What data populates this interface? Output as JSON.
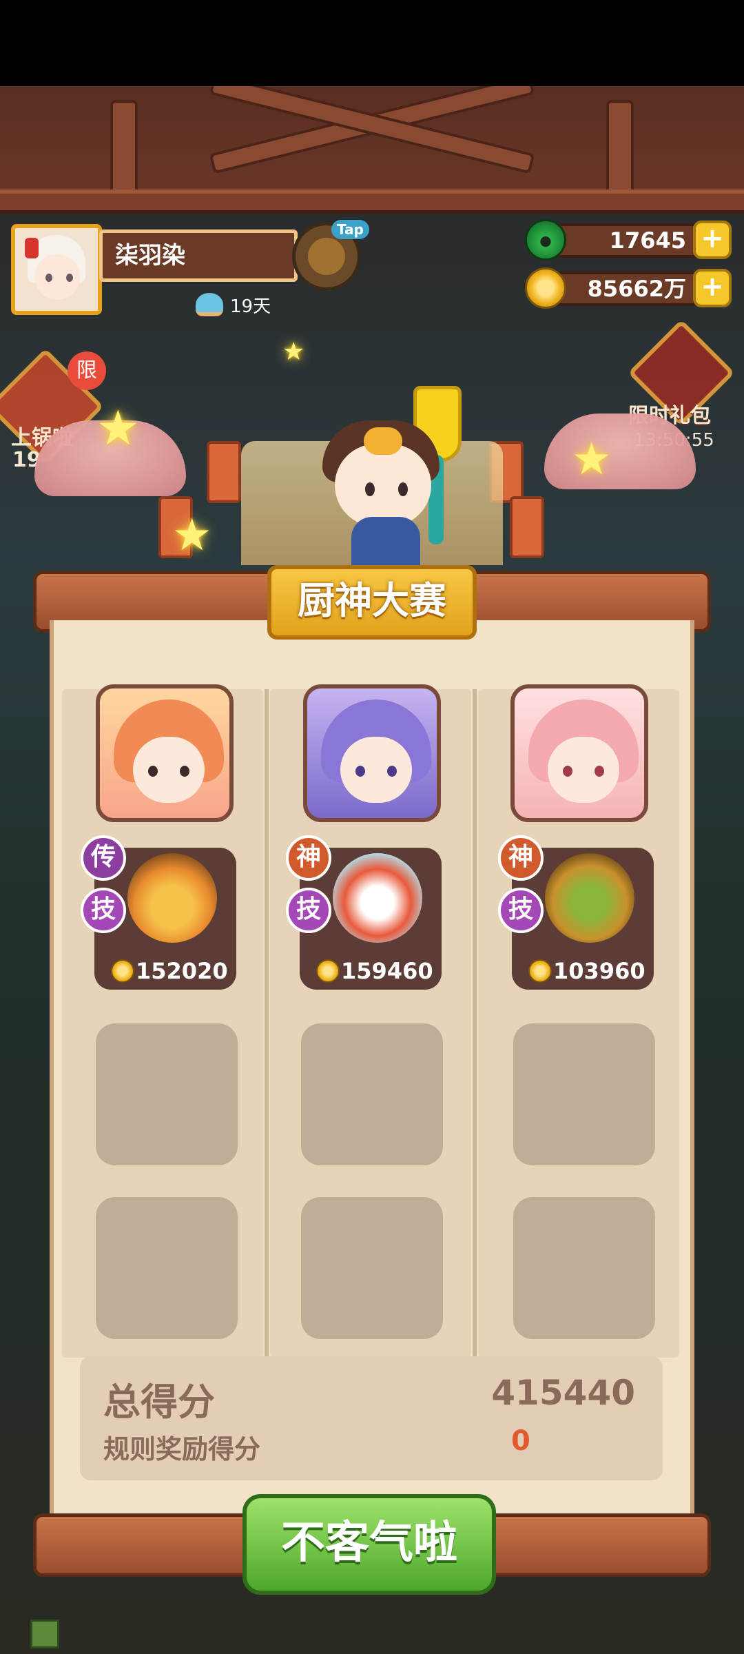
{
  "player": {
    "name": "柒羽染",
    "days": "19天",
    "tap_label": "Tap"
  },
  "currencies": {
    "jade": "17645",
    "coins": "85662万",
    "plus": "+"
  },
  "side": {
    "left_label": "上锅啦",
    "left_badge": "限",
    "left_num": "19",
    "right_label": "限时礼包",
    "right_timer": "13:50:55"
  },
  "contest": {
    "title": "厨神大赛"
  },
  "lanes": [
    {
      "rank": "传",
      "skill": "技",
      "price": "152020",
      "rank_type": "legend"
    },
    {
      "rank": "神",
      "skill": "技",
      "price": "159460",
      "rank_type": "god"
    },
    {
      "rank": "神",
      "skill": "技",
      "price": "103960",
      "rank_type": "god"
    }
  ],
  "score": {
    "total_label": "总得分",
    "total_value": "415440",
    "bonus_label": "规则奖励得分",
    "bonus_value": "0"
  },
  "confirm_button": "不客气啦",
  "colors": {
    "accent_gold": "#f8c744",
    "confirm_green": "#4ea72c",
    "bonus_red": "#e05a2c",
    "board": "#f1e2c8"
  },
  "icons": [
    "jade-icon",
    "coin-icon",
    "plus-icon",
    "days-icon",
    "tap-bun-icon",
    "coin-small-icon"
  ]
}
